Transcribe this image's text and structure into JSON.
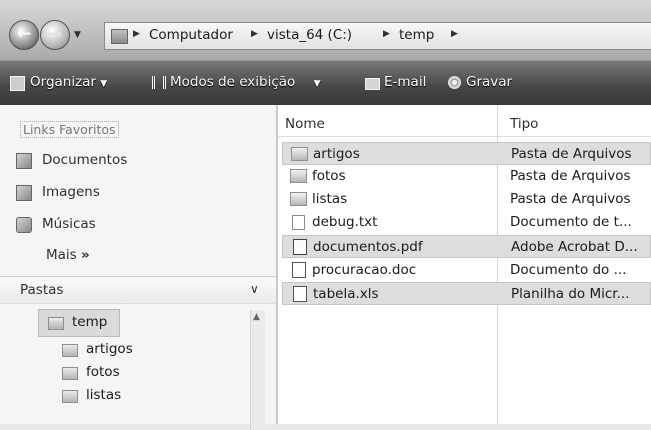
{
  "nav": {
    "back_glyph": "←",
    "forward_glyph": "→",
    "history_glyph": "▼"
  },
  "address": {
    "crumbs": [
      "Computador",
      "vista_64 (C:)",
      "temp"
    ],
    "separator": "▶"
  },
  "toolbar": {
    "organize": "Organizar",
    "views": "Modos de exibição",
    "email": "E-mail",
    "burn": "Gravar",
    "dropdown_glyph": "▼"
  },
  "navpane": {
    "favorites_header": "Links Favoritos",
    "favorites": [
      {
        "label": "Documentos",
        "icon": "documents-icon"
      },
      {
        "label": "Imagens",
        "icon": "pictures-icon"
      },
      {
        "label": "Músicas",
        "icon": "music-icon"
      }
    ],
    "more": "Mais",
    "more_glyph": "»",
    "folders_header": "Pastas",
    "folders_chevron": "∨",
    "tree": [
      "temp",
      "artigos",
      "fotos",
      "listas"
    ]
  },
  "filelist": {
    "columns": [
      "Nome",
      "Tipo"
    ],
    "rows": [
      {
        "name": "artigos",
        "type": "Pasta de Arquivos",
        "icon": "folder-icon",
        "highlight": true
      },
      {
        "name": "fotos",
        "type": "Pasta de Arquivos",
        "icon": "folder-icon",
        "highlight": false
      },
      {
        "name": "listas",
        "type": "Pasta de Arquivos",
        "icon": "folder-icon",
        "highlight": false
      },
      {
        "name": "debug.txt",
        "type": "Documento de t...",
        "icon": "text-file-icon",
        "highlight": false
      },
      {
        "name": "documentos.pdf",
        "type": "Adobe Acrobat D...",
        "icon": "pdf-file-icon",
        "highlight": true
      },
      {
        "name": "procuracao.doc",
        "type": "Documento do ...",
        "icon": "word-file-icon",
        "highlight": false
      },
      {
        "name": "tabela.xls",
        "type": "Planilha do Micr...",
        "icon": "excel-file-icon",
        "highlight": true
      }
    ]
  }
}
